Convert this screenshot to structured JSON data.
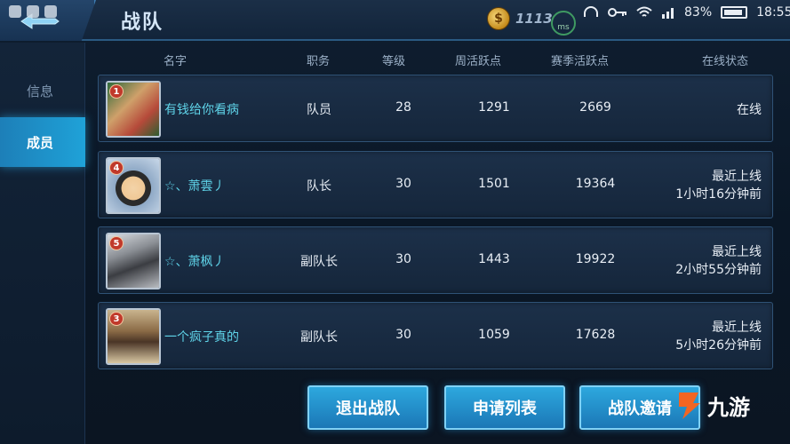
{
  "header": {
    "title": "战队",
    "coins": "1113",
    "ping_label": "ms",
    "battery_percent": "83%",
    "time": "18:55"
  },
  "sidebar": {
    "items": [
      {
        "label": "信息",
        "active": false
      },
      {
        "label": "成员",
        "active": true
      }
    ]
  },
  "table": {
    "headers": {
      "name": "名字",
      "role": "职务",
      "level": "等级",
      "weekly": "周活跃点",
      "season": "赛季活跃点",
      "online": "在线状态"
    },
    "rows": [
      {
        "rank": "1",
        "name": "有钱给你看病",
        "role": "队员",
        "level": "28",
        "weekly": "1291",
        "season": "2669",
        "online_line1": "在线",
        "online_line2": ""
      },
      {
        "rank": "4",
        "name": "☆、萧雲丿",
        "role": "队长",
        "level": "30",
        "weekly": "1501",
        "season": "19364",
        "online_line1": "最近上线",
        "online_line2": "1小时16分钟前"
      },
      {
        "rank": "5",
        "name": "☆、萧枫丿",
        "role": "副队长",
        "level": "30",
        "weekly": "1443",
        "season": "19922",
        "online_line1": "最近上线",
        "online_line2": "2小时55分钟前"
      },
      {
        "rank": "3",
        "name": "一个疯子真的",
        "role": "副队长",
        "level": "30",
        "weekly": "1059",
        "season": "17628",
        "online_line1": "最近上线",
        "online_line2": "5小时26分钟前"
      }
    ]
  },
  "actions": {
    "quit": "退出战队",
    "apply_list": "申请列表",
    "invite": "战队邀请"
  },
  "watermark": {
    "text": "九游"
  },
  "colors": {
    "accent": "#1fa2d8",
    "name_text": "#5fd3e8",
    "row_bg": "#1c3049",
    "rank_badge": "#c0392b"
  }
}
